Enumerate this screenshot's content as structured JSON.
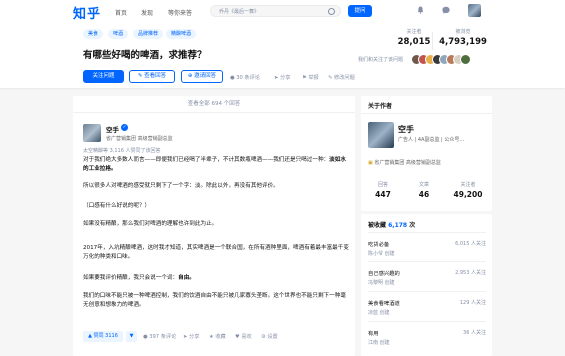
{
  "topbar": {
    "logo": "知乎",
    "nav": [
      "首页",
      "发现",
      "等你来答"
    ],
    "search_placeholder": "乔丹《最后一舞》",
    "ask_button": "提问"
  },
  "question": {
    "tags": [
      "美食",
      "啤酒",
      "品牌推荐",
      "精酿啤酒"
    ],
    "title": "有哪些好喝的啤酒，求推荐？",
    "follow_button": "关注问题",
    "view_answers_button": "查看回答",
    "invite_button": "邀请回答",
    "actions": [
      "30 条评论",
      "分享",
      "举报",
      "修改问题"
    ],
    "followers_label": "关注者",
    "followers": "28,015",
    "views_label": "被浏览",
    "views": "4,793,199",
    "friends_text": "我们和关注了该问题"
  },
  "answers": {
    "view_all": "查看全部 694 个回答",
    "author_name": "空手",
    "author_headline": "省广营销集团 高级营销副总监",
    "vote_text": "太空精酿等 3,116 人赞同了该回答",
    "paragraphs": [
      {
        "pre": "对于我们绝大多数人而言——即便我们已经喝了半辈子，不计其数瓶啤酒——我们还是只喝过一种：",
        "bold": "淡如水的工业拉格。"
      },
      {
        "pre": "所以很多人对啤酒的感受就只剩下了一个字：淡。除此以外，再没有其他评价。",
        "bold": ""
      },
      {
        "pre": "（口感有什么好说的呢？）",
        "bold": ""
      },
      {
        "pre": "如果没有精酿，那么我们对啤酒的理解也许到此为止。",
        "bold": ""
      },
      {
        "pre": "2017年，入坑精酿啤酒，这时我才知道，其实啤酒是一个联合国，在所有酒种里面，啤酒有着最丰富最千变万化的种类和口味。",
        "bold": ""
      },
      {
        "pre": "如果要我评价精酿，我只会说一个词：",
        "bold": "自由。"
      },
      {
        "pre": "我们的口味不能只被一种啤酒控制，我们的饮酒自由不能只被几家寡头垄断。这个世界也不能只剩下一种毫无创意和想象力的啤酒。",
        "bold": ""
      }
    ],
    "vote_button": "▲ 赞同 3116",
    "down_button": "▼",
    "action_items": [
      "397 条评论",
      "分享",
      "收藏",
      "喜欢",
      "设置"
    ]
  },
  "about": {
    "title": "关于作者",
    "name": "空手",
    "headline": "广告人 | 4A副总监 | 公众号…",
    "org": "省广营销集团 高级营销副总监",
    "stats": [
      {
        "label": "回答",
        "value": "447"
      },
      {
        "label": "文章",
        "value": "46"
      },
      {
        "label": "关注者",
        "value": "49,200"
      }
    ]
  },
  "collections": {
    "title_prefix": "被收藏",
    "count": "6,178",
    "title_suffix": "次",
    "items": [
      {
        "name": "吃货必备",
        "by": "陈小爷 创建",
        "followers": "6,015 人关注"
      },
      {
        "name": "自己感兴趣的",
        "by": "冯黎明 创建",
        "followers": "2,953 人关注"
      },
      {
        "name": "美食看啤酒道",
        "by": "凉蓝 创建",
        "followers": "129 人关注"
      },
      {
        "name": "有用",
        "by": "江南 创建",
        "followers": "36 人关注"
      }
    ]
  },
  "colors": {
    "brand": "#0066ff",
    "meta": "#8590a6",
    "background": "#f6f6f6"
  }
}
